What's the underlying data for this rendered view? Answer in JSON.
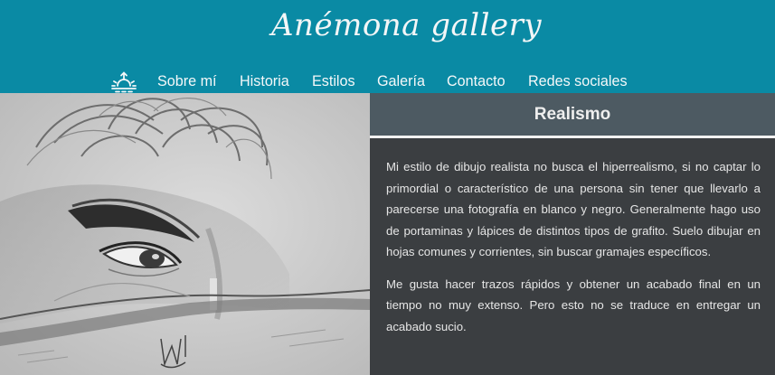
{
  "site": {
    "title": "Anémona gallery"
  },
  "nav": {
    "home_icon": "sunrise-icon",
    "items": [
      {
        "label": "Sobre mí"
      },
      {
        "label": "Historia"
      },
      {
        "label": "Estilos"
      },
      {
        "label": "Galería"
      },
      {
        "label": "Contacto"
      },
      {
        "label": "Redes sociales"
      }
    ]
  },
  "section": {
    "title": "Realismo",
    "paragraphs": [
      "Mi estilo de dibujo realista no busca el hiperrealismo, si no captar lo primordial o característico de una persona sin tener que llevarlo a parecerse una fotografía en blanco y negro. Generalmente hago uso de portaminas y lápices de distintos tipos de grafito. Suelo dibujar en hojas comunes y corrientes, sin buscar gramajes específicos.",
      "Me gusta hacer trazos rápidos y obtener un acabado final en un tiempo no muy extenso. Pero esto no se traduce en entregar un acabado sucio."
    ]
  },
  "colors": {
    "header": "#0a8aa4",
    "section_head": "#4d5a62",
    "content_bg": "#3b3e41",
    "text": "#e6e6e6"
  }
}
